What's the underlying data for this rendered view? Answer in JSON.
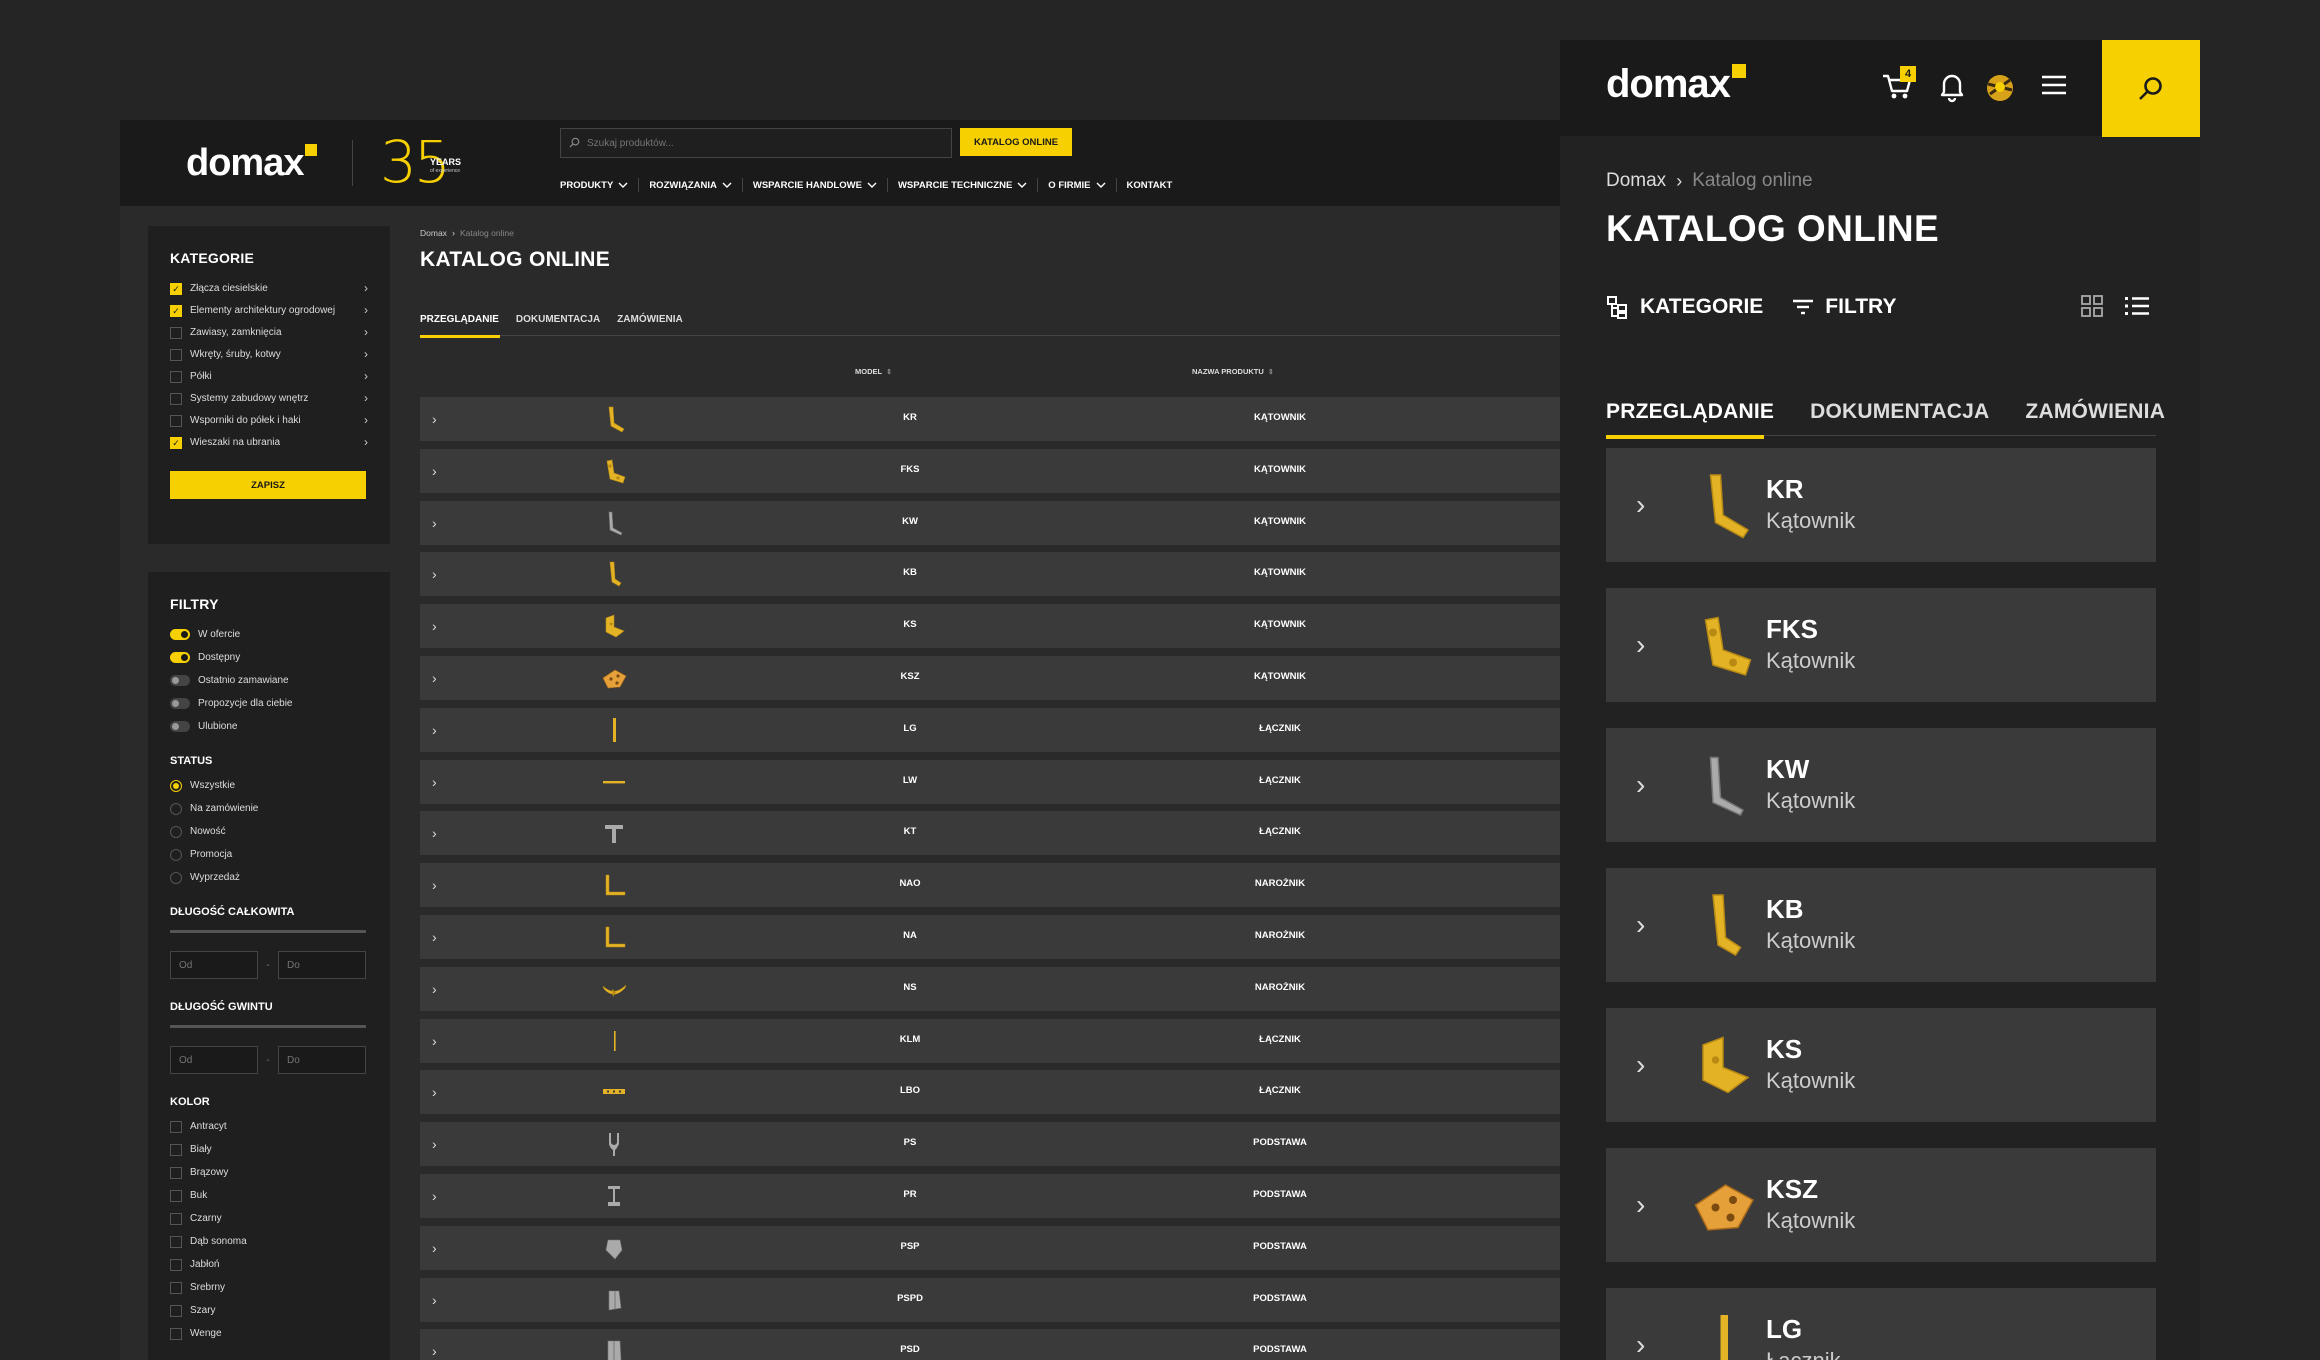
{
  "brand": {
    "logo": "domax",
    "years_num": "35",
    "years_word": "YEARS",
    "years_sub": "of experience"
  },
  "search": {
    "placeholder": "Szukaj produktów..."
  },
  "header": {
    "catalog_button": "KATALOG ONLINE"
  },
  "nav": [
    {
      "label": "PRODUKTY",
      "dropdown": true
    },
    {
      "label": "ROZWIĄZANIA",
      "dropdown": true
    },
    {
      "label": "WSPARCIE HANDLOWE",
      "dropdown": true
    },
    {
      "label": "WSPARCIE TECHNICZNE",
      "dropdown": true
    },
    {
      "label": "O FIRMIE",
      "dropdown": true
    },
    {
      "label": "KONTAKT",
      "dropdown": false
    }
  ],
  "categories": {
    "title": "KATEGORIE",
    "items": [
      {
        "label": "Złącza ciesielskie",
        "checked": true
      },
      {
        "label": "Elementy architektury ogrodowej",
        "checked": true
      },
      {
        "label": "Zawiasy, zamknięcia",
        "checked": false
      },
      {
        "label": "Wkręty, śruby, kotwy",
        "checked": false
      },
      {
        "label": "Półki",
        "checked": false
      },
      {
        "label": "Systemy zabudowy wnętrz",
        "checked": false
      },
      {
        "label": "Wsporniki do półek i haki",
        "checked": false
      },
      {
        "label": "Wieszaki na ubrania",
        "checked": true
      }
    ],
    "save": "ZAPISZ"
  },
  "filters": {
    "title": "FILTRY",
    "toggles": [
      {
        "label": "W ofercie",
        "on": true
      },
      {
        "label": "Dostępny",
        "on": true
      },
      {
        "label": "Ostatnio zamawiane",
        "on": false
      },
      {
        "label": "Propozycje dla ciebie",
        "on": false
      },
      {
        "label": "Ulubione",
        "on": false
      }
    ],
    "status_title": "STATUS",
    "status": [
      {
        "label": "Wszystkie",
        "on": true
      },
      {
        "label": "Na zamówienie",
        "on": false
      },
      {
        "label": "Nowość",
        "on": false
      },
      {
        "label": "Promocja",
        "on": false
      },
      {
        "label": "Wyprzedaż",
        "on": false
      }
    ],
    "length_title": "DŁUGOŚĆ CAŁKOWITA",
    "thread_title": "DŁUGOŚĆ GWINTU",
    "from_placeholder": "Od",
    "to_placeholder": "Do",
    "range_dash": "-",
    "color_title": "KOLOR",
    "colors": [
      "Antracyt",
      "Biały",
      "Brązowy",
      "Buk",
      "Czarny",
      "Dąb sonoma",
      "Jabłoń",
      "Srebrny",
      "Szary",
      "Wenge"
    ]
  },
  "breadcrumb": {
    "home": "Domax",
    "current": "Katalog online"
  },
  "page": {
    "title": "KATALOG ONLINE"
  },
  "tabs": [
    "PRZEGLĄDANIE",
    "DOKUMENTACJA",
    "ZAMÓWIENIA"
  ],
  "table": {
    "col_model": "MODEL",
    "col_name": "NAZWA PRODUKTU",
    "rows": [
      {
        "model": "KR",
        "name": "KĄTOWNIK",
        "icon": "bracket-l-icon"
      },
      {
        "model": "FKS",
        "name": "KĄTOWNIK",
        "icon": "bracket-fks-icon"
      },
      {
        "model": "KW",
        "name": "KĄTOWNIK",
        "icon": "bracket-silver-icon"
      },
      {
        "model": "KB",
        "name": "KĄTOWNIK",
        "icon": "bracket-kb-icon"
      },
      {
        "model": "KS",
        "name": "KĄTOWNIK",
        "icon": "bracket-ks-icon"
      },
      {
        "model": "KSZ",
        "name": "KĄTOWNIK",
        "icon": "bracket-ksz-icon"
      },
      {
        "model": "LG",
        "name": "ŁĄCZNIK",
        "icon": "connector-flat-icon"
      },
      {
        "model": "LW",
        "name": "ŁĄCZNIK",
        "icon": "connector-wide-icon"
      },
      {
        "model": "KT",
        "name": "ŁĄCZNIK",
        "icon": "connector-t-icon"
      },
      {
        "model": "NAO",
        "name": "NAROŻNIK",
        "icon": "corner-l-icon"
      },
      {
        "model": "NA",
        "name": "NAROŻNIK",
        "icon": "corner-l-icon"
      },
      {
        "model": "NS",
        "name": "NAROŻNIK",
        "icon": "corner-curved-icon"
      },
      {
        "model": "KLM",
        "name": "ŁĄCZNIK",
        "icon": "connector-thin-icon"
      },
      {
        "model": "LBO",
        "name": "ŁĄCZNIK",
        "icon": "connector-perforated-icon"
      },
      {
        "model": "PS",
        "name": "PODSTAWA",
        "icon": "base-fork-icon"
      },
      {
        "model": "PR",
        "name": "PODSTAWA",
        "icon": "base-r-icon"
      },
      {
        "model": "PSP",
        "name": "PODSTAWA",
        "icon": "base-psp-icon"
      },
      {
        "model": "PSPD",
        "name": "PODSTAWA",
        "icon": "base-pspd-icon"
      },
      {
        "model": "PSD",
        "name": "PODSTAWA",
        "icon": "base-psd-icon"
      }
    ]
  },
  "mobile": {
    "cart_count": "4",
    "breadcrumb": {
      "home": "Domax",
      "current": "Katalog online"
    },
    "title": "KATALOG ONLINE",
    "tool_categories": "KATEGORIE",
    "tool_filters": "FILTRY",
    "tabs": [
      "PRZEGLĄDANIE",
      "DOKUMENTACJA",
      "ZAMÓWIENIA"
    ],
    "cards": [
      {
        "model": "KR",
        "name": "Kątownik"
      },
      {
        "model": "FKS",
        "name": "Kątownik"
      },
      {
        "model": "KW",
        "name": "Kątownik"
      },
      {
        "model": "KB",
        "name": "Kątownik"
      },
      {
        "model": "KS",
        "name": "Kątownik"
      },
      {
        "model": "KSZ",
        "name": "Kątownik"
      },
      {
        "model": "LG",
        "name": "Łącznik"
      }
    ]
  },
  "colors": {
    "accent": "#f6d000",
    "bg": "#252525",
    "row": "#3a3a3a",
    "panel": "#1f1f1f"
  }
}
